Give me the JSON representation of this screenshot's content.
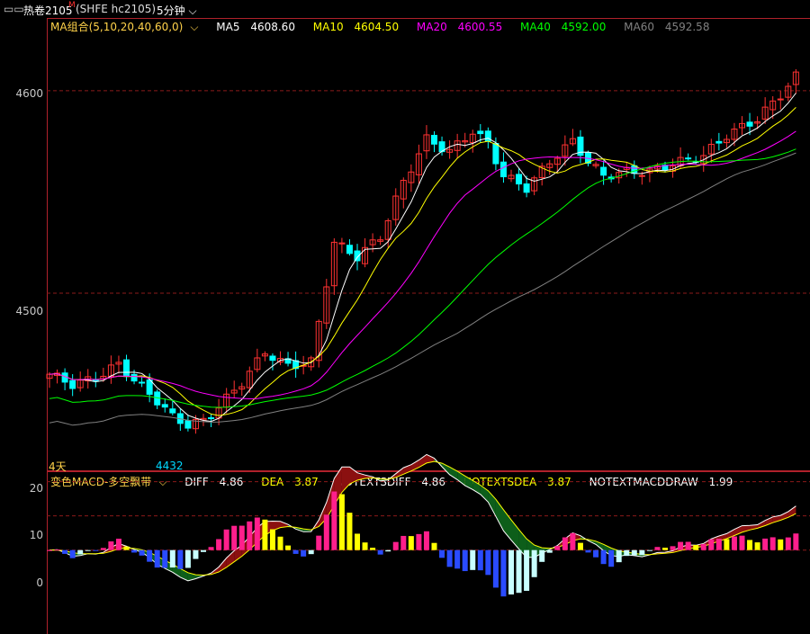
{
  "header": {
    "icon": "window-icon",
    "symbol": "热卷2105",
    "symbol_mark": "M",
    "exchange_code": "(SHFE hc2105)",
    "period": "5分钟"
  },
  "main_legend": {
    "indicator": "MA组合(5,10,20,40,60,0)",
    "items": [
      {
        "label": "MA5",
        "value": "4608.60",
        "color": "#ffffff"
      },
      {
        "label": "MA10",
        "value": "4604.50",
        "color": "#ffff00"
      },
      {
        "label": "MA20",
        "value": "4600.55",
        "color": "#ff00ff"
      },
      {
        "label": "MA40",
        "value": "4592.00",
        "color": "#00ff00"
      },
      {
        "label": "MA60",
        "value": "4592.58",
        "color": "#808080"
      }
    ]
  },
  "sub_legend": {
    "indicator": "变色MACD-多空飘带",
    "items": [
      {
        "label": "DIFF",
        "value": "4.86",
        "color": "#ffffff"
      },
      {
        "label": "DEA",
        "value": "3.87",
        "color": "#ffff00"
      },
      {
        "label": "NOTEXTSDIFF",
        "value": "4.86",
        "color": "#ffffff"
      },
      {
        "label": "NOTEXTSDEA",
        "value": "3.87",
        "color": "#ffff00"
      },
      {
        "label": "NOTEXTMACDDRAW",
        "value": "1.99",
        "color": "#ffffff"
      }
    ]
  },
  "annotations": {
    "low_price": "4432",
    "days_label": "4天"
  },
  "colors": {
    "up": "#ff3232",
    "down": "#00ffff",
    "grid": "#8b1a1a",
    "frame": "#b0212b",
    "macd_up": "#ff1f8c",
    "macd_up_fade": "#ffff00",
    "macd_down": "#2a4bff",
    "macd_down_fade": "#c8ffff",
    "band_bull": "#8b1010",
    "band_bear": "#0d5e1a"
  },
  "chart_data": [
    {
      "type": "candlestick",
      "ylim": [
        4413,
        4635
      ],
      "yticks": [
        4500,
        4600
      ],
      "ytick_labels": [
        "4500",
        "4600"
      ],
      "close_anchors": [
        [
          0,
          4460
        ],
        [
          3,
          4455
        ],
        [
          6,
          4458
        ],
        [
          9,
          4465
        ],
        [
          11,
          4457
        ],
        [
          14,
          4447
        ],
        [
          16,
          4439
        ],
        [
          18,
          4435
        ],
        [
          20,
          4437
        ],
        [
          22,
          4444
        ],
        [
          25,
          4456
        ],
        [
          28,
          4471
        ],
        [
          31,
          4464
        ],
        [
          34,
          4466
        ],
        [
          37,
          4525
        ],
        [
          40,
          4518
        ],
        [
          43,
          4528
        ],
        [
          46,
          4555
        ],
        [
          49,
          4576
        ],
        [
          52,
          4570
        ],
        [
          55,
          4580
        ],
        [
          57,
          4574
        ],
        [
          59,
          4558
        ],
        [
          62,
          4552
        ],
        [
          65,
          4565
        ],
        [
          68,
          4575
        ],
        [
          70,
          4565
        ],
        [
          72,
          4558
        ],
        [
          75,
          4560
        ],
        [
          78,
          4560
        ],
        [
          81,
          4564
        ],
        [
          85,
          4568
        ],
        [
          88,
          4578
        ],
        [
          92,
          4586
        ],
        [
          95,
          4598
        ],
        [
          97,
          4607
        ]
      ],
      "count": 98,
      "series": [
        {
          "name": "MA5",
          "window": 5
        },
        {
          "name": "MA10",
          "window": 10
        },
        {
          "name": "MA20",
          "window": 20
        },
        {
          "name": "MA40",
          "window": 40
        },
        {
          "name": "MA60",
          "window": 60
        }
      ]
    },
    {
      "type": "bar",
      "ylim": [
        -24,
        22
      ],
      "yticks": [
        0,
        10,
        20
      ],
      "ytick_labels": [
        "0",
        "10",
        "20"
      ],
      "series": [
        {
          "name": "DIFF"
        },
        {
          "name": "DEA"
        },
        {
          "name": "MACD"
        }
      ]
    }
  ]
}
